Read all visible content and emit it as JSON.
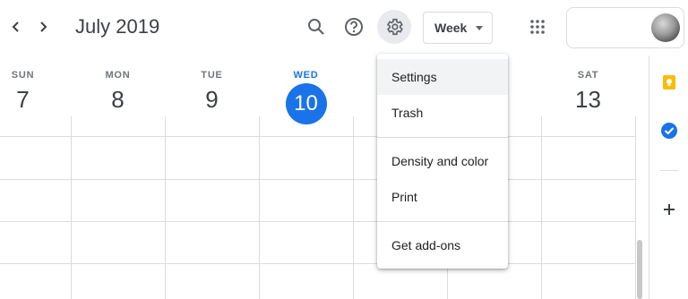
{
  "header": {
    "title": "July 2019",
    "view_select": "Week",
    "prev_icon": "chevron-left-icon",
    "next_icon": "chevron-right-icon"
  },
  "week": {
    "days": [
      {
        "dow": "SUN",
        "date": "7"
      },
      {
        "dow": "MON",
        "date": "8"
      },
      {
        "dow": "TUE",
        "date": "9"
      },
      {
        "dow": "WED",
        "date": "10",
        "today": true
      },
      {
        "dow": "SAT",
        "date": "13"
      }
    ]
  },
  "settings_menu": {
    "items": [
      {
        "label": "Settings"
      },
      {
        "label": "Trash"
      },
      {
        "label": "Density and color"
      },
      {
        "label": "Print"
      },
      {
        "label": "Get add-ons"
      }
    ]
  },
  "colors": {
    "accent": "#1a73e8",
    "keep_yellow": "#fbbc04",
    "tasks_blue": "#1a73e8"
  }
}
